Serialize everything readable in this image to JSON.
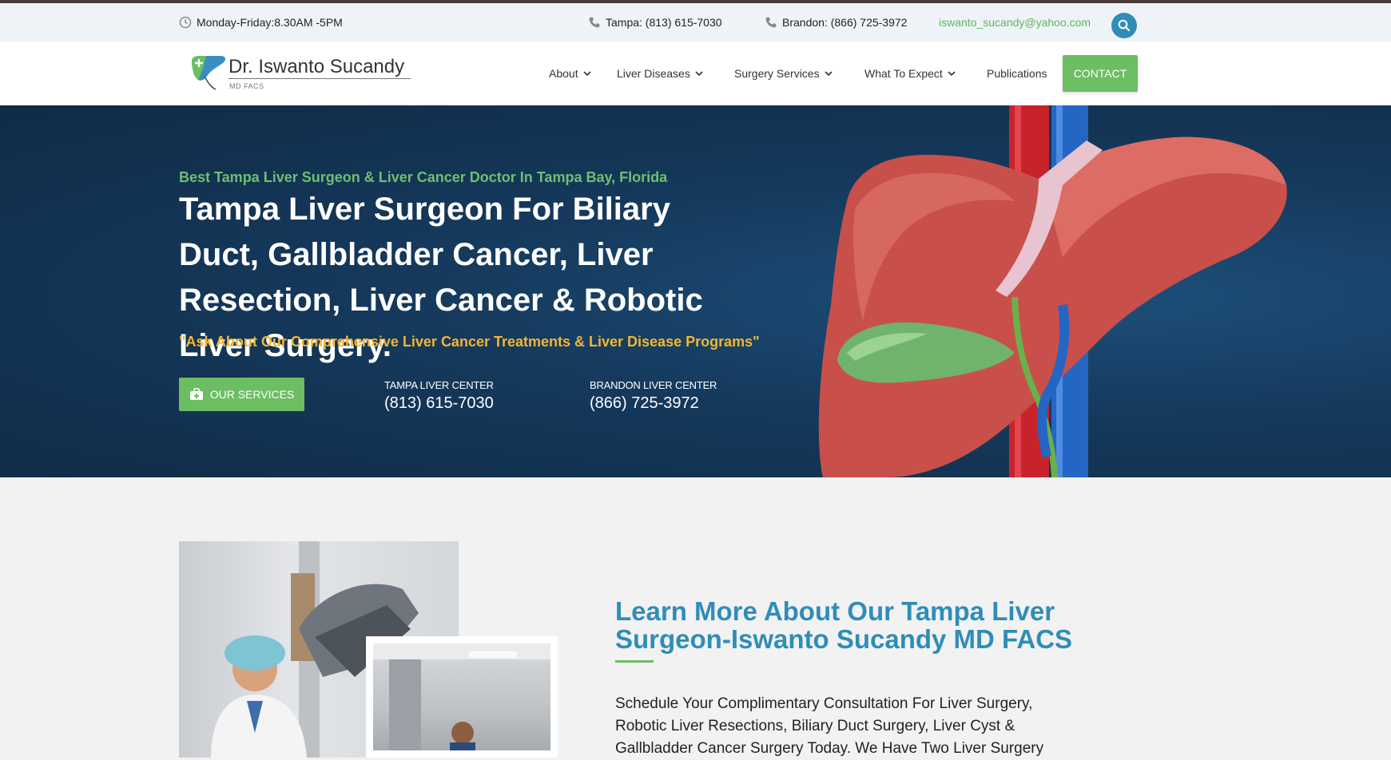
{
  "topbar": {
    "hours": "Monday-Friday:8.30AM -5PM",
    "tampa_phone": "Tampa: (813) 615-7030",
    "brandon_phone": "Brandon: (866) 725-3972",
    "email": "iswanto_sucandy@yahoo.com"
  },
  "logo": {
    "name": "Dr. Iswanto Sucandy",
    "credentials": "MD FACS"
  },
  "nav": {
    "items": [
      "About",
      "Liver Diseases",
      "Surgery Services",
      "What To Expect",
      "Publications"
    ],
    "contact_label": "CONTACT"
  },
  "hero": {
    "subtitle": "Best Tampa Liver Surgeon & Liver Cancer Doctor In Tampa Bay, Florida",
    "title": "Tampa Liver Surgeon For Biliary Duct, Gallbladder Cancer, Liver Resection, Liver Cancer & Robotic Liver Surgery.",
    "quote": "\"Ask About Our Comprehensive Liver Cancer Treatments & Liver Disease Programs\"",
    "services_label": "OUR SERVICES",
    "centers": [
      {
        "name": "TAMPA LIVER CENTER",
        "phone": "(813) 615-7030"
      },
      {
        "name": "BRANDON LIVER CENTER",
        "phone": "(866) 725-3972"
      }
    ]
  },
  "about": {
    "title": "Learn More About Our Tampa Liver Surgeon-Iswanto Sucandy MD FACS",
    "body": "Schedule Your Complimentary Consultation For Liver Surgery, Robotic Liver Resections, Biliary Duct Surgery, Liver Cyst & Gallbladder Cancer Surgery Today. We Have Two Liver Surgery"
  },
  "colors": {
    "accent_green": "#6dbd63",
    "accent_blue": "#2f8db8",
    "quote_yellow": "#f2b632",
    "hero_bg": "#15395c"
  }
}
